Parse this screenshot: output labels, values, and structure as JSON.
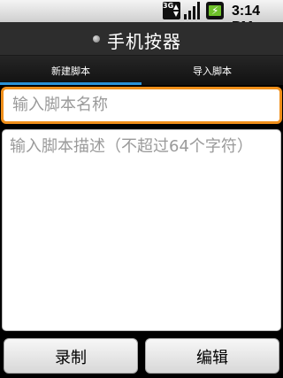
{
  "status_bar": {
    "network_label": "3G",
    "time": "3:14",
    "ampm": "PM",
    "icons": [
      "3g-data-icon",
      "signal-strength-icon",
      "battery-charging-icon"
    ]
  },
  "app": {
    "title": "手机按器"
  },
  "tabs": [
    {
      "label": "新建脚本",
      "selected": true
    },
    {
      "label": "导入脚本",
      "selected": false
    }
  ],
  "form": {
    "name_placeholder": "输入脚本名称",
    "description_placeholder": "输入脚本描述（不超过64个字符）"
  },
  "buttons": {
    "record_label": "录制",
    "edit_label": "编辑"
  },
  "colors": {
    "accent": "#2a92d8",
    "focus_border": "#f08f1a"
  }
}
